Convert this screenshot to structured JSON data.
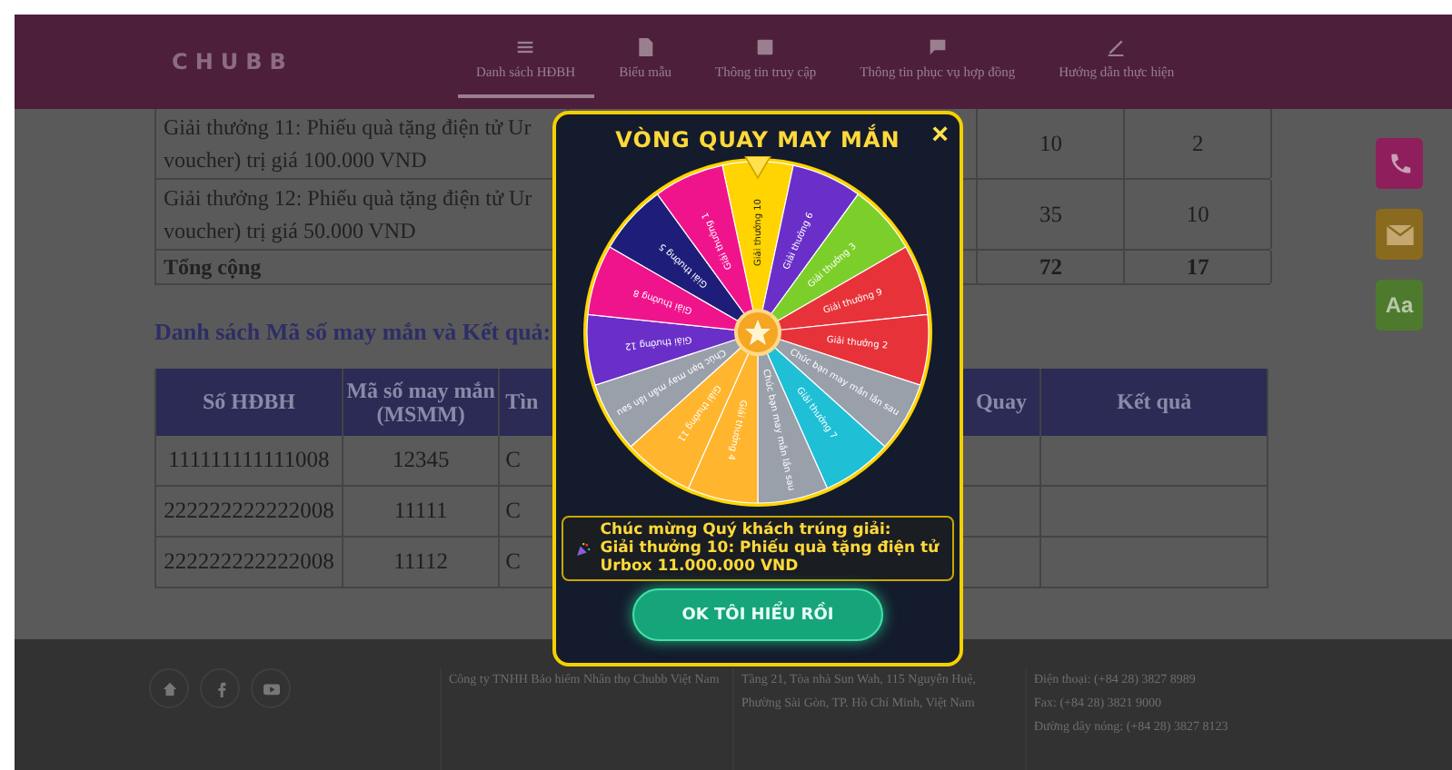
{
  "header": {
    "logo": "CHUBB",
    "nav": [
      {
        "label": "Danh sách HĐBH",
        "selected": true
      },
      {
        "label": "Biểu mẫu",
        "selected": false
      },
      {
        "label": "Thông tin truy cập",
        "selected": false
      },
      {
        "label": "Thông tin phục vụ hợp đồng",
        "selected": false
      },
      {
        "label": "Hướng dẫn thực hiện",
        "selected": false
      }
    ]
  },
  "prize_table": {
    "rows": [
      {
        "lines": [
          "Giải thưởng 11: Phiếu quà tặng điện tử Ur",
          "voucher) trị giá 100.000 VND"
        ],
        "column_3": "10",
        "column_4": "2",
        "total": false
      },
      {
        "lines": [
          "Giải thưởng 12: Phiếu quà tặng điện tử Ur",
          "voucher) trị giá 50.000 VND"
        ],
        "column_3": "35",
        "column_4": "10",
        "total": false
      },
      {
        "lines": [
          "Tổng cộng"
        ],
        "column_3": "72",
        "column_4": "17",
        "total": true
      }
    ]
  },
  "results_heading": "Danh sách Mã số may mắn và Kết quả:",
  "results_table": {
    "columns": [
      "Số HĐBH",
      "Mã số may mắn (MSMM)",
      "Tìn",
      "Quay",
      "Kết quả"
    ],
    "rows": [
      [
        "111111111111008",
        "12345",
        "C"
      ],
      [
        "222222222222008",
        "11111",
        "C"
      ],
      [
        "222222222222008",
        "11112",
        "C"
      ]
    ]
  },
  "side_buttons": [
    {
      "kind": "phone",
      "color": "#8e1f5c"
    },
    {
      "kind": "mail",
      "color": "#8a6a1e"
    },
    {
      "kind": "text",
      "label": "Aa",
      "color": "#4e7a2e"
    }
  ],
  "footer": {
    "company": "Công ty TNHH Bảo hiểm Nhân thọ Chubb Việt Nam",
    "address": "Tầng 21, Tòa nhà Sun Wah, 115 Nguyễn Huệ, Phường Sài Gòn, TP. Hồ Chí Minh, Việt Nam",
    "contacts": [
      "Điện thoại: (+84 28) 3827 8989",
      "Fax: (+84 28) 3821 9000",
      "Đường dây nóng: (+84 28) 3827 8123"
    ]
  },
  "dialog": {
    "title": "VÒNG QUAY MAY MẮN",
    "close": "×",
    "wheel": [
      {
        "label": "Giải thưởng 10",
        "color": "#ffd400"
      },
      {
        "label": "Giải thưởng 6",
        "color": "#6a2fc9"
      },
      {
        "label": "Giải thưởng 3",
        "color": "#7ccf2a"
      },
      {
        "label": "Giải thưởng 9",
        "color": "#e8323a"
      },
      {
        "label": "Giải thưởng 2",
        "color": "#e8323a"
      },
      {
        "label": "Chúc bạn may mắn lần sau",
        "color": "#9aa0aa"
      },
      {
        "label": "Giải thưởng 7",
        "color": "#1fbfd6"
      },
      {
        "label": "Chúc bạn may mắn lần sau",
        "color": "#9aa0aa"
      },
      {
        "label": "Giải thưởng 4",
        "color": "#ffb52e"
      },
      {
        "label": "Giải thưởng 11",
        "color": "#ffb52e"
      },
      {
        "label": "Chúc bạn may mắn lần sau",
        "color": "#9aa0aa"
      },
      {
        "label": "Giải thưởng 12",
        "color": "#6a2fc9"
      },
      {
        "label": "Giải thưởng 8",
        "color": "#f0148c"
      },
      {
        "label": "Giải thưởng 5",
        "color": "#1e1e7a"
      },
      {
        "label": "Giải thưởng 1",
        "color": "#f0148c"
      }
    ],
    "result_lines": [
      "Chúc mừng Quý khách trúng giải:",
      "Giải thưởng 10: Phiếu quà tặng điện tử Urbox 11.000.000 VND"
    ],
    "button": "OK TÔI HIỂU RỒI"
  }
}
